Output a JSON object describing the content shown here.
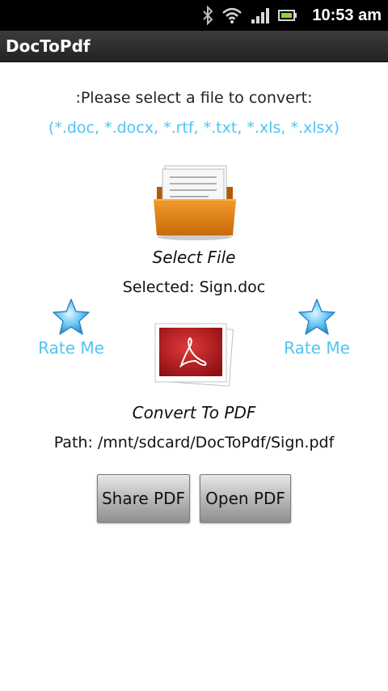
{
  "status_bar": {
    "time": "10:53 am",
    "icons": [
      "bluetooth-icon",
      "wifi-icon",
      "signal-icon",
      "battery-icon"
    ]
  },
  "app": {
    "title": "DocToPdf"
  },
  "main": {
    "prompt": ":Please select a file to convert:",
    "formats": "(*.doc, *.docx, *.rtf, *.txt, *.xls, *.xlsx)",
    "select_file_label": "Select File",
    "selected_text": "Selected: Sign.doc",
    "rate_left_label": "Rate Me",
    "rate_right_label": "Rate Me",
    "convert_label": "Convert To PDF",
    "path_text": "Path: /mnt/sdcard/DocToPdf/Sign.pdf",
    "share_button": "Share PDF",
    "open_button": "Open PDF"
  },
  "colors": {
    "accent": "#4fc4f2",
    "title_bar": "#2e2e2e",
    "status_bar": "#000000"
  }
}
